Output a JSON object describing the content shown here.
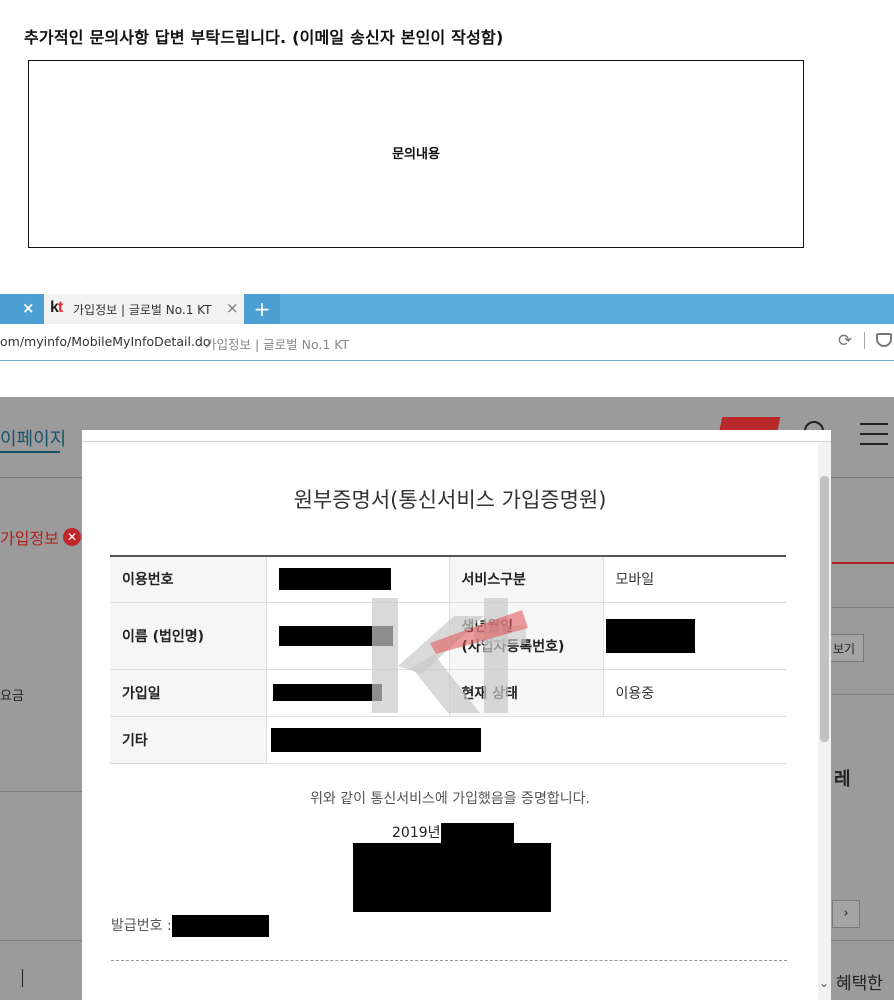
{
  "question": {
    "title": "추가적인 문의사항 답변 부탁드립니다. (이메일 송신자 본인이 작성함)",
    "box_label": "문의내용"
  },
  "browser": {
    "tab_logo": "kt",
    "tab_title": "가입정보 | 글로벌 No.1 KT",
    "close_glyph": "×",
    "add_tab_glyph": "+",
    "url": "om/myinfo/MobileMyInfoDetail.do",
    "page_title": "가입정보 | 글로벌 No.1 KT"
  },
  "background_page": {
    "nav_title": "이페이지",
    "join_info_tab": "가입정보",
    "fee_label": "요금",
    "view_button": "보기",
    "side_text": "레",
    "chevron": "›",
    "benefit_text": "혜택한"
  },
  "certificate": {
    "title": "원부증명서(통신서비스 가입증명원)",
    "rows": {
      "usage_number_label": "이용번호",
      "service_type_label": "서비스구분",
      "service_type_value": "모바일",
      "name_label": "이름 (법인명)",
      "birth_label_line1": "생년월일",
      "birth_label_line2": "(사업자등록번호)",
      "join_date_label": "가입일",
      "status_label": "현재 상태",
      "status_value": "이용중",
      "etc_label": "기타"
    },
    "certify_text": "위와 같이 통신서비스에 가입했음을 증명합니다.",
    "date_prefix": "2019년",
    "issue_number_label": "발급번호 :"
  },
  "colors": {
    "tabbar": "#5aabdb",
    "kt_red": "#c0262a",
    "page_dim": "#9b9b9b",
    "nav_title": "#17536b"
  }
}
